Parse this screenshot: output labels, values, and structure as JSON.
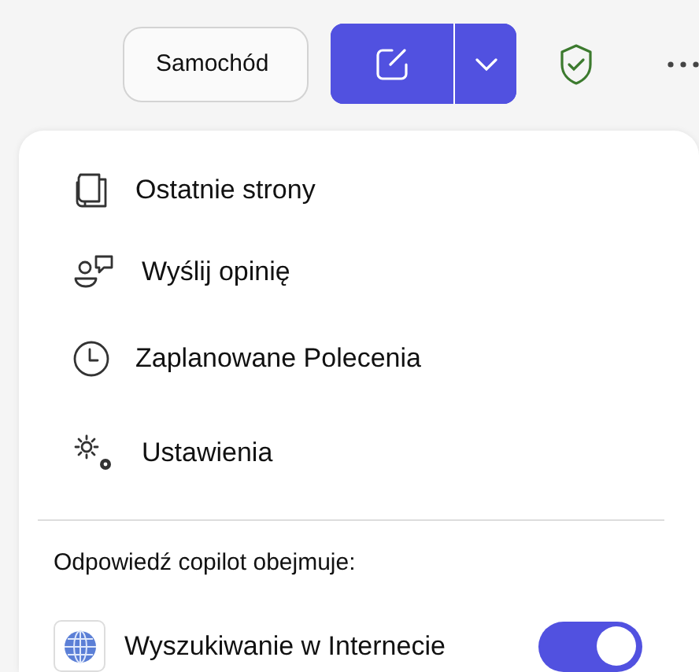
{
  "toolbar": {
    "profile_button": "Samochód",
    "security_ok": true
  },
  "menu": {
    "items": [
      {
        "kind": "pages",
        "label": "Ostatnie strony"
      },
      {
        "kind": "feedback",
        "label": "Wyślij opinię"
      },
      {
        "kind": "schedule",
        "label": "Zaplanowane Polecenia"
      },
      {
        "kind": "settings",
        "label": "Ustawienia"
      }
    ],
    "section_title": "Odpowiedź copilot obejmuje:",
    "options": [
      {
        "label": "Wyszukiwanie w Internecie",
        "on": true
      }
    ]
  }
}
